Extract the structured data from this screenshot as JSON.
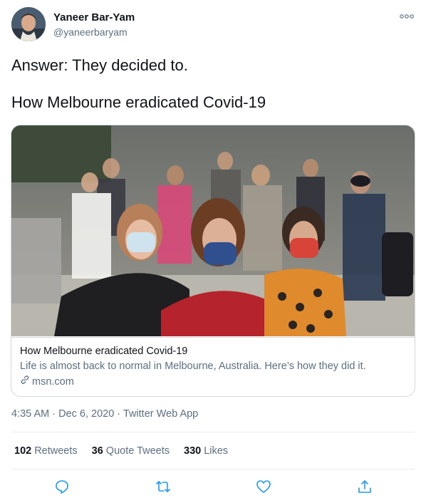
{
  "author": {
    "display_name": "Yaneer Bar-Yam",
    "handle": "@yaneerbaryam",
    "avatar_icon": "avatar"
  },
  "tweet": {
    "line1": "Answer: They decided to.",
    "line2": "How Melbourne eradicated Covid-19"
  },
  "card": {
    "title": "How Melbourne eradicated Covid-19",
    "description": "Life is almost back to normal in Melbourne, Australia. Here’s how they did it.",
    "domain": "msn.com",
    "image_icon": "crowd-photo"
  },
  "meta": {
    "timestamp": "4:35 AM · Dec 6, 2020 · Twitter Web App"
  },
  "stats": {
    "retweets_count": "102",
    "retweets_label": "Retweets",
    "quotes_count": "36",
    "quotes_label": "Quote Tweets",
    "likes_count": "330",
    "likes_label": "Likes"
  },
  "colors": {
    "secondary_text": "#5b7083",
    "border": "#cfd9de",
    "icon": "#1d9bf0"
  }
}
